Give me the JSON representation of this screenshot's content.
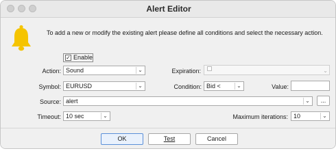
{
  "window": {
    "title": "Alert Editor"
  },
  "message": "To add a new or modify the existing alert please define all conditions and select the necessary action.",
  "enable": {
    "label": "Enable",
    "checked": true
  },
  "action": {
    "label": "Action:",
    "value": "Sound"
  },
  "expiration": {
    "label": "Expiration:",
    "value": ""
  },
  "symbol": {
    "label": "Symbol:",
    "value": "EURUSD"
  },
  "condition": {
    "label": "Condition:",
    "value": "Bid <"
  },
  "value_field": {
    "label": "Value:",
    "value": ""
  },
  "source": {
    "label": "Source:",
    "value": "alert",
    "browse": "..."
  },
  "timeout": {
    "label": "Timeout:",
    "value": "10 sec"
  },
  "max_iterations": {
    "label": "Maximum iterations:",
    "value": "10"
  },
  "buttons": {
    "ok": "OK",
    "test": "Test",
    "cancel": "Cancel"
  },
  "colors": {
    "bell": "#f5c400",
    "default_button_border": "#5a8fd8"
  }
}
